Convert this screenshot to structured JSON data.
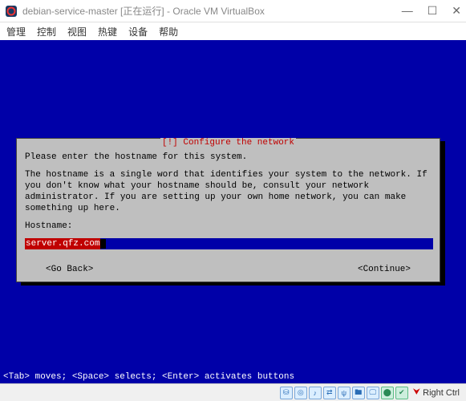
{
  "titlebar": {
    "title": "debian-service-master [正在运行] - Oracle VM VirtualBox"
  },
  "menubar": {
    "items": [
      "管理",
      "控制",
      "视图",
      "热键",
      "设备",
      "帮助"
    ]
  },
  "dialog": {
    "title": "[!] Configure the network",
    "prompt": "Please enter the hostname for this system.",
    "description": "The hostname is a single word that identifies your system to the network. If you don't know what your hostname should be, consult your network administrator. If you are setting up your own home network, you can make something up here.",
    "field_label": "Hostname:",
    "field_value": "server.qfz.com",
    "go_back": "<Go Back>",
    "continue": "<Continue>"
  },
  "hint": "<Tab> moves; <Space> selects; <Enter> activates buttons",
  "statusbar": {
    "host_key": "Right Ctrl"
  }
}
